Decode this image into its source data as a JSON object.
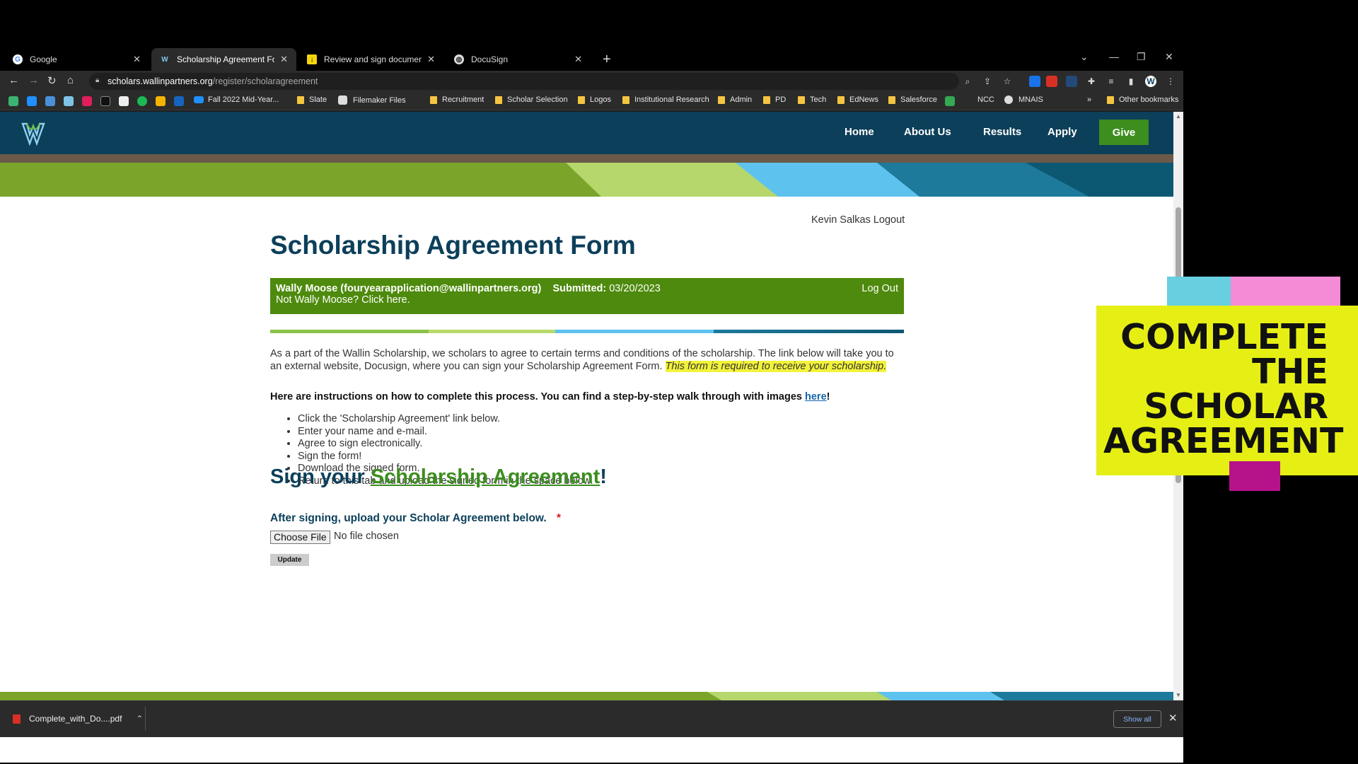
{
  "tabs": [
    {
      "title": "Google",
      "favicon": "google-icon"
    },
    {
      "title": "Scholarship Agreement Form",
      "favicon": "wallin-icon"
    },
    {
      "title": "Review and sign document(s) | D",
      "favicon": "docusign-icon"
    },
    {
      "title": "DocuSign",
      "favicon": "globe-icon"
    }
  ],
  "address": {
    "domain": "scholars.wallinpartners.org",
    "path": "/register/scholaragreement"
  },
  "bookmarks": [
    "Fall 2022 Mid-Year...",
    "Slate",
    "Filemaker Files",
    "Recruitment",
    "Scholar Selection",
    "Logos",
    "Institutional Research",
    "Admin",
    "PD",
    "Tech",
    "EdNews",
    "Salesforce",
    "NCC",
    "MNAIS",
    "Other bookmarks"
  ],
  "nav": {
    "home": "Home",
    "about": "About Us",
    "results": "Results",
    "apply": "Apply",
    "give": "Give"
  },
  "page": {
    "user_logout": "Kevin Salkas Logout",
    "title": "Scholarship Agreement Form",
    "info": {
      "name_email": "Wally Moose (fouryearapplication@wallinpartners.org)",
      "submitted_label": "Submitted:",
      "submitted_date": "03/20/2023",
      "logout": "Log Out",
      "not_user": "Not Wally Moose? Click here."
    },
    "intro": "As a part of the Wallin Scholarship, we scholars to agree to certain terms and conditions of the scholarship. The link below will take you to an external website, Docusign, where you can sign your Scholarship Agreement Form.",
    "intro_highlight": "This form is required to receive your scholarship.",
    "instructions": "Here are instructions on how to complete this process. You can find a step-by-step walk through with images",
    "instructions_link": "here",
    "steps": [
      "Click the 'Scholarship Agreement' link below.",
      "Enter your name and e-mail.",
      "Agree to sign electronically.",
      "Sign the form!",
      "Download the signed form.",
      "Return to this tab and upload the signed form in the space below."
    ],
    "sign_prefix": "Sign your",
    "sign_link": "Scholarship Agreement",
    "upload_label": "After signing, upload your Scholar Agreement below.",
    "required_mark": "*",
    "choose_file": "Choose File",
    "no_file": "No file chosen",
    "update": "Update"
  },
  "download": {
    "file": "Complete_with_Do....pdf",
    "show_all": "Show all"
  },
  "sticky_note": {
    "lines": [
      "COMPLETE",
      "THE",
      "SCHOLAR",
      "AGREEMENT"
    ]
  },
  "colors": {
    "navy": "#0c3f5a",
    "green": "#4e8a0d",
    "give_green": "#3c8e1f",
    "sticky_yellow": "#e6ef14"
  }
}
